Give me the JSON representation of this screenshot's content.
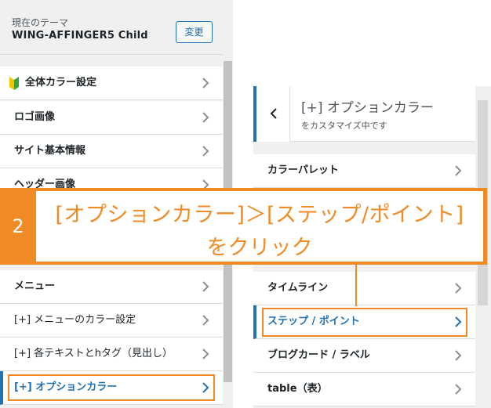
{
  "theme": {
    "label": "現在のテーマ",
    "name": "WING-AFFINGER5 Child",
    "change_label": "変更"
  },
  "left_menu": {
    "items": [
      {
        "label": "全体カラー設定",
        "icon": "beginner-mark-icon"
      },
      {
        "label": "ロゴ画像"
      },
      {
        "label": "サイト基本情報"
      },
      {
        "label": "ヘッダー画像"
      },
      {
        "label": "メニュー"
      },
      {
        "label": "[+] メニューのカラー設定"
      },
      {
        "label": "[+] 各テキストとhタグ（見出し）"
      },
      {
        "label": "[+] オプションカラー"
      }
    ]
  },
  "sub_panel": {
    "title": "[+] オプションカラー",
    "description": "をカスタマイズ中です",
    "items": [
      {
        "label": "カラーパレット"
      },
      {
        "label": "タイムライン"
      },
      {
        "label": "ステップ / ポイント"
      },
      {
        "label": "ブログカード / ラベル"
      },
      {
        "label": "table（表）"
      }
    ]
  },
  "callout": {
    "number": "2",
    "line1": "[オプションカラー]＞[ステップ/ポイント]",
    "line2": "をクリック"
  },
  "colors": {
    "accent": "#f08a24",
    "wp_blue": "#2271b1",
    "panel_bg": "#f0f0f1"
  }
}
